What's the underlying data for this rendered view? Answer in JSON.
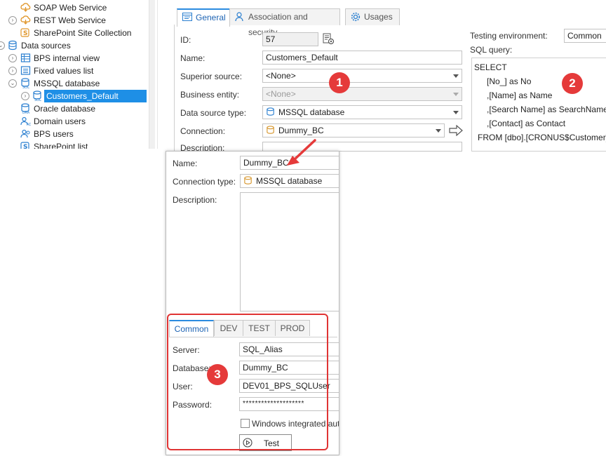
{
  "tree": {
    "items": [
      {
        "label": "SOAP Web Service",
        "icon": "cloud-web-service-icon"
      },
      {
        "label": "REST Web Service",
        "icon": "cloud-web-service-icon"
      },
      {
        "label": "SharePoint Site Collection",
        "icon": "sharepoint-icon"
      },
      {
        "label": "Data sources",
        "icon": "database-icon"
      },
      {
        "label": "BPS internal view",
        "icon": "table-view-icon"
      },
      {
        "label": "Fixed values list",
        "icon": "list-icon"
      },
      {
        "label": "MSSQL database",
        "icon": "mssql-database-icon"
      },
      {
        "label": "Customers_Default",
        "icon": "sql-icon"
      },
      {
        "label": "Oracle database",
        "icon": "oracle-database-icon"
      },
      {
        "label": "Domain users",
        "icon": "users-icon"
      },
      {
        "label": "BPS users",
        "icon": "users-icon"
      },
      {
        "label": "SharePoint list",
        "icon": "sharepoint-icon"
      }
    ]
  },
  "props": {
    "tabs": [
      "General",
      "Association and security",
      "Usages"
    ],
    "fields": {
      "id_label": "ID:",
      "id_value": "57",
      "name_label": "Name:",
      "name_value": "Customers_Default",
      "superior_label": "Superior source:",
      "superior_value": "<None>",
      "entity_label": "Business entity:",
      "entity_value": "<None>",
      "type_label": "Data source type:",
      "type_value": "MSSQL database",
      "connection_label": "Connection:",
      "connection_value": "Dummy_BC",
      "description_label": "Description:"
    },
    "testing_env_label": "Testing environment:",
    "testing_env_value": "Common",
    "sql_label": "SQL query:",
    "sql_lines": [
      "SELECT",
      "[No_] as No",
      ",[Name] as Name",
      ",[Search Name] as SearchName",
      ",[Contact] as Contact",
      "FROM [dbo].[CRONUS$Customer]"
    ]
  },
  "dialog": {
    "name_label": "Name:",
    "name_value": "Dummy_BC",
    "conn_type_label": "Connection type:",
    "conn_type_value": "MSSQL database",
    "description_label": "Description:",
    "env_tabs": [
      "Common",
      "DEV",
      "TEST",
      "PROD"
    ],
    "server_label": "Server:",
    "server_value": "SQL_Alias",
    "database_label": "Database:",
    "database_value": "Dummy_BC",
    "user_label": "User:",
    "user_value": "DEV01_BPS_SQLUser",
    "password_label": "Password:",
    "password_value": "********************",
    "windows_auth_label": "Windows integrated authe",
    "test_button": "Test"
  },
  "annotations": {
    "badge1": "1",
    "badge2": "2",
    "badge3": "3",
    "color": "#e53a3a"
  },
  "colors": {
    "accent": "#1e8fe6",
    "tab_accent": "#2b8be0",
    "highlight_red": "#e03434"
  }
}
